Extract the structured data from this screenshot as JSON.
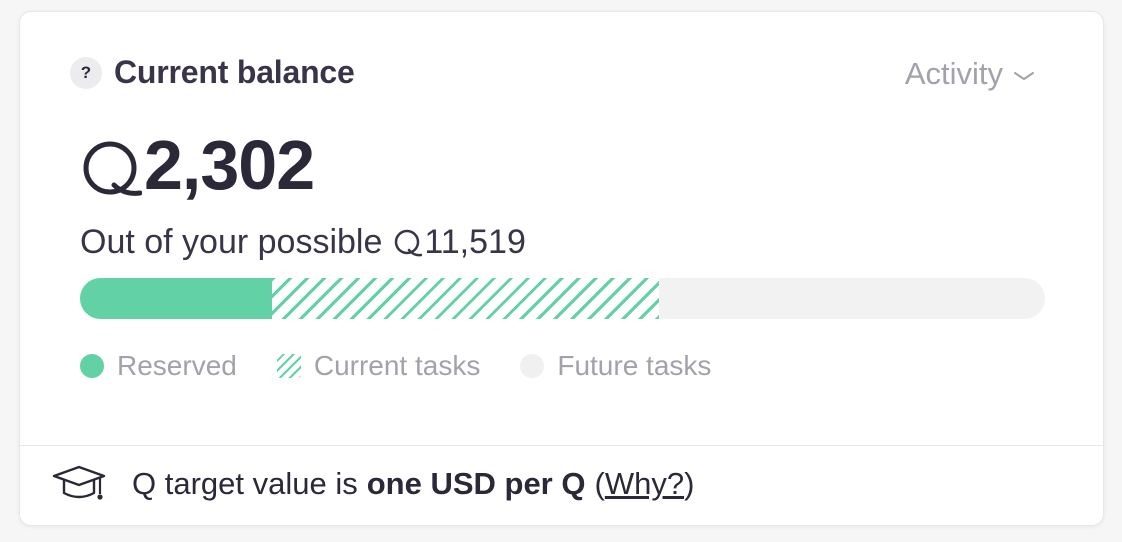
{
  "header": {
    "help_icon": "?",
    "title": "Current balance",
    "activity_label": "Activity"
  },
  "balance": {
    "currency_icon": "q-currency-icon",
    "amount": "2,302",
    "possible_text": "Out of your possible",
    "possible_amount": "11,519"
  },
  "progress": {
    "reserved_fraction": 0.199,
    "current_tasks_fraction": 0.401,
    "future_tasks_fraction": 0.4
  },
  "legend": {
    "reserved": "Reserved",
    "current_tasks": "Current tasks",
    "future_tasks": "Future tasks"
  },
  "footer": {
    "icon": "graduation-cap-icon",
    "text_prefix": "Q target value is",
    "text_bold": "one USD per Q",
    "paren_open": "(",
    "why_link": "Why?",
    "paren_close": ")"
  },
  "colors": {
    "accent_green": "#62d1a6",
    "muted_text": "#a3a1ab",
    "dark_text": "#2b2838",
    "track": "#f2f2f3"
  }
}
